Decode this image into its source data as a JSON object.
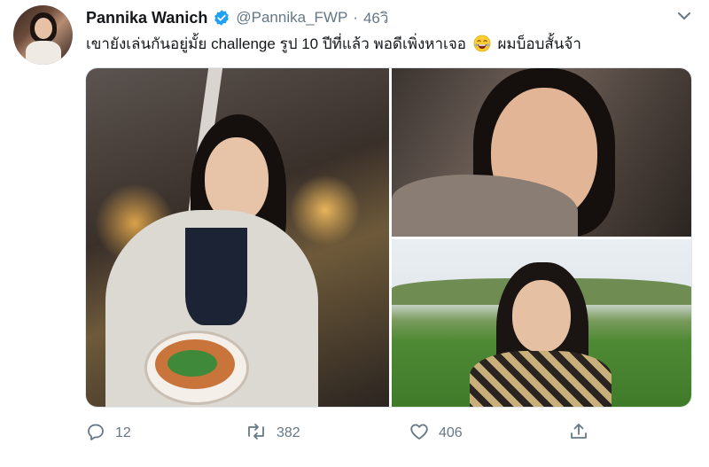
{
  "tweet": {
    "author_name": "Pannika Wanich",
    "handle": "@Pannika_FWP",
    "separator": "·",
    "time": "46วิ",
    "text_before_emoji": "เขายังเล่นกันอยู่มั้ย challenge รูป 10 ปีที่แล้ว พอดีเพิ่งหาเจอ",
    "text_after_emoji": "ผมบ็อบสั้นจ้า",
    "emoji": "face-with-tears-of-joy"
  },
  "actions": {
    "reply_count": "12",
    "retweet_count": "382",
    "like_count": "406"
  },
  "colors": {
    "verified": "#1da1f2",
    "secondary_text": "#657786",
    "primary_text": "#14171a"
  },
  "media": {
    "photo_count": 3
  }
}
